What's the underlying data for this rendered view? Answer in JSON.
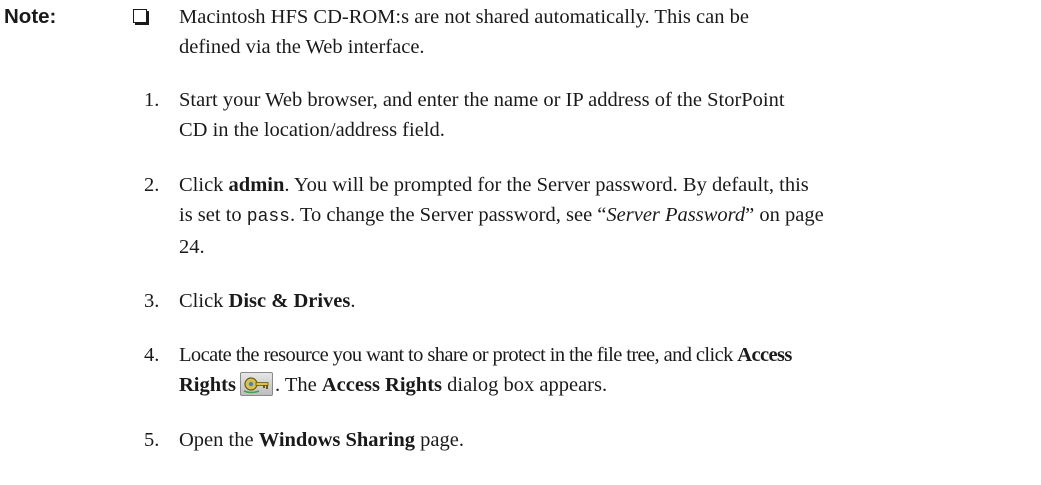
{
  "note": {
    "label": "Note:",
    "text_line1": "Macintosh HFS CD-ROM:s are not shared automatically. This can be",
    "text_line2": "defined via the Web interface."
  },
  "steps": [
    {
      "number": "1.",
      "line1": "Start your Web browser, and enter the name or IP address of the StorPoint",
      "line2": "CD in the location/address field."
    },
    {
      "number": "2.",
      "pre": "Click ",
      "bold": "admin",
      "line1_rest": ". You will be prompted for the Server password. By default, this",
      "line2_pre": "is set to ",
      "code": "pass",
      "line2_mid": ". To change the Server password, see “",
      "italic": "Server Password",
      "line2_post": "” on page",
      "line3": "24."
    },
    {
      "number": "3.",
      "pre": "Click ",
      "bold": "Disc & Drives",
      "post": "."
    },
    {
      "number": "4.",
      "line1_pre": "Locate the resource you want to share or protect in the file tree, and click ",
      "bold1": "Access",
      "bold2": "Rights",
      "icon": "access-rights-key-icon",
      "mid": ". The ",
      "bold3": "Access Rights",
      "post": " dialog box appears."
    },
    {
      "number": "5.",
      "pre": "Open the ",
      "bold": "Windows Sharing",
      "post": " page."
    }
  ]
}
